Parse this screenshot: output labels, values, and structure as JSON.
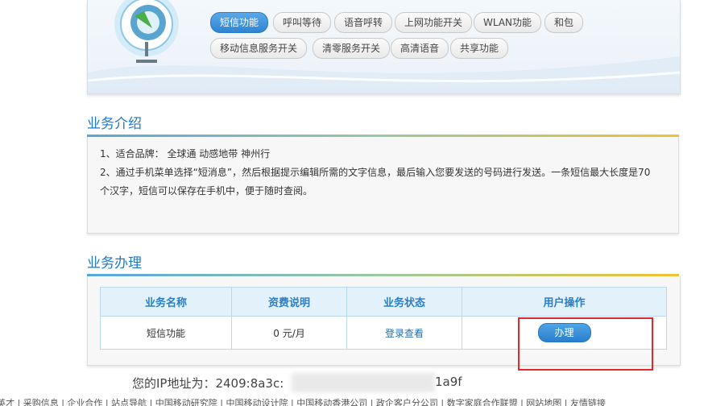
{
  "tags_row1": [
    "短信功能",
    "呼叫等待",
    "语音呼转",
    "上网功能开关",
    "WLAN功能",
    "和包"
  ],
  "tags_row2": [
    "移动信息服务开关",
    "清零服务开关",
    "高清语音",
    "共享功能"
  ],
  "intro": {
    "title": "业务介绍",
    "line1": "1、适合品牌： 全球通 动感地带 神州行",
    "line2": "2、通过手机菜单选择“短消息”，然后根据提示编辑所需的文字信息，最后输入您要发送的号码进行发送。一条短信最大长度是70",
    "line3": "个汉字，短信可以保存在手机中，便于随时查阅。"
  },
  "handle": {
    "title": "业务办理",
    "headers": [
      "业务名称",
      "资费说明",
      "业务状态",
      "用户操作"
    ],
    "row": {
      "name": "短信功能",
      "fee": "0 元/月",
      "status": "登录查看",
      "action": "办理"
    }
  },
  "ip": {
    "prefix": "您的IP地址为：2409:8a3c:",
    "suffix": "1a9f"
  },
  "footer": "英才 | 采购信息 | 企业合作 | 站点导航 | 中国移动研究院 | 中国移动设计院 | 中国移动香港公司 | 政企客户分公司 | 数字家庭合作联盟 | 网站地图 | 友情链接"
}
